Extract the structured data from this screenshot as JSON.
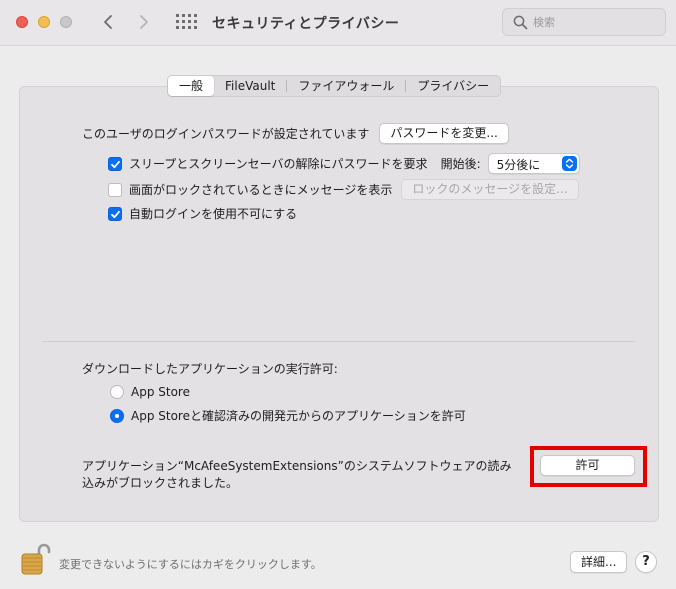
{
  "window": {
    "title": "セキュリティとプライバシー"
  },
  "search": {
    "placeholder": "検索"
  },
  "tabs": [
    {
      "label": "一般",
      "active": true
    },
    {
      "label": "FileVault",
      "active": false
    },
    {
      "label": "ファイアウォール",
      "active": false
    },
    {
      "label": "プライバシー",
      "active": false
    }
  ],
  "general": {
    "password_status": "このユーザのログインパスワードが設定されています",
    "change_password_button": "パスワードを変更...",
    "require_password": {
      "label": "スリープとスクリーンセーバの解除にパスワードを要求",
      "checked": true,
      "after_label": "開始後:",
      "after_value": "5分後に"
    },
    "lock_message": {
      "label": "画面がロックされているときにメッセージを表示",
      "checked": false,
      "button": "ロックのメッセージを設定..."
    },
    "disable_autologin": {
      "label": "自動ログインを使用不可にする",
      "checked": true
    }
  },
  "downloads": {
    "heading": "ダウンロードしたアプリケーションの実行許可:",
    "options": [
      {
        "label": "App Store",
        "selected": false
      },
      {
        "label": "App Storeと確認済みの開発元からのアプリケーションを許可",
        "selected": true
      }
    ]
  },
  "blocked": {
    "message_line1": "アプリケーション“McAfeeSystemExtensions”のシステムソフトウェアの読み",
    "message_line2": "込みがブロックされました。",
    "allow_button": "許可",
    "highlight_color": "#e30000"
  },
  "footer": {
    "lock_text": "変更できないようにするにはカギをクリックします。",
    "details_button": "詳細...",
    "help_button": "?"
  },
  "colors": {
    "accent": "#0a6ff5",
    "highlight": "#e30000"
  }
}
